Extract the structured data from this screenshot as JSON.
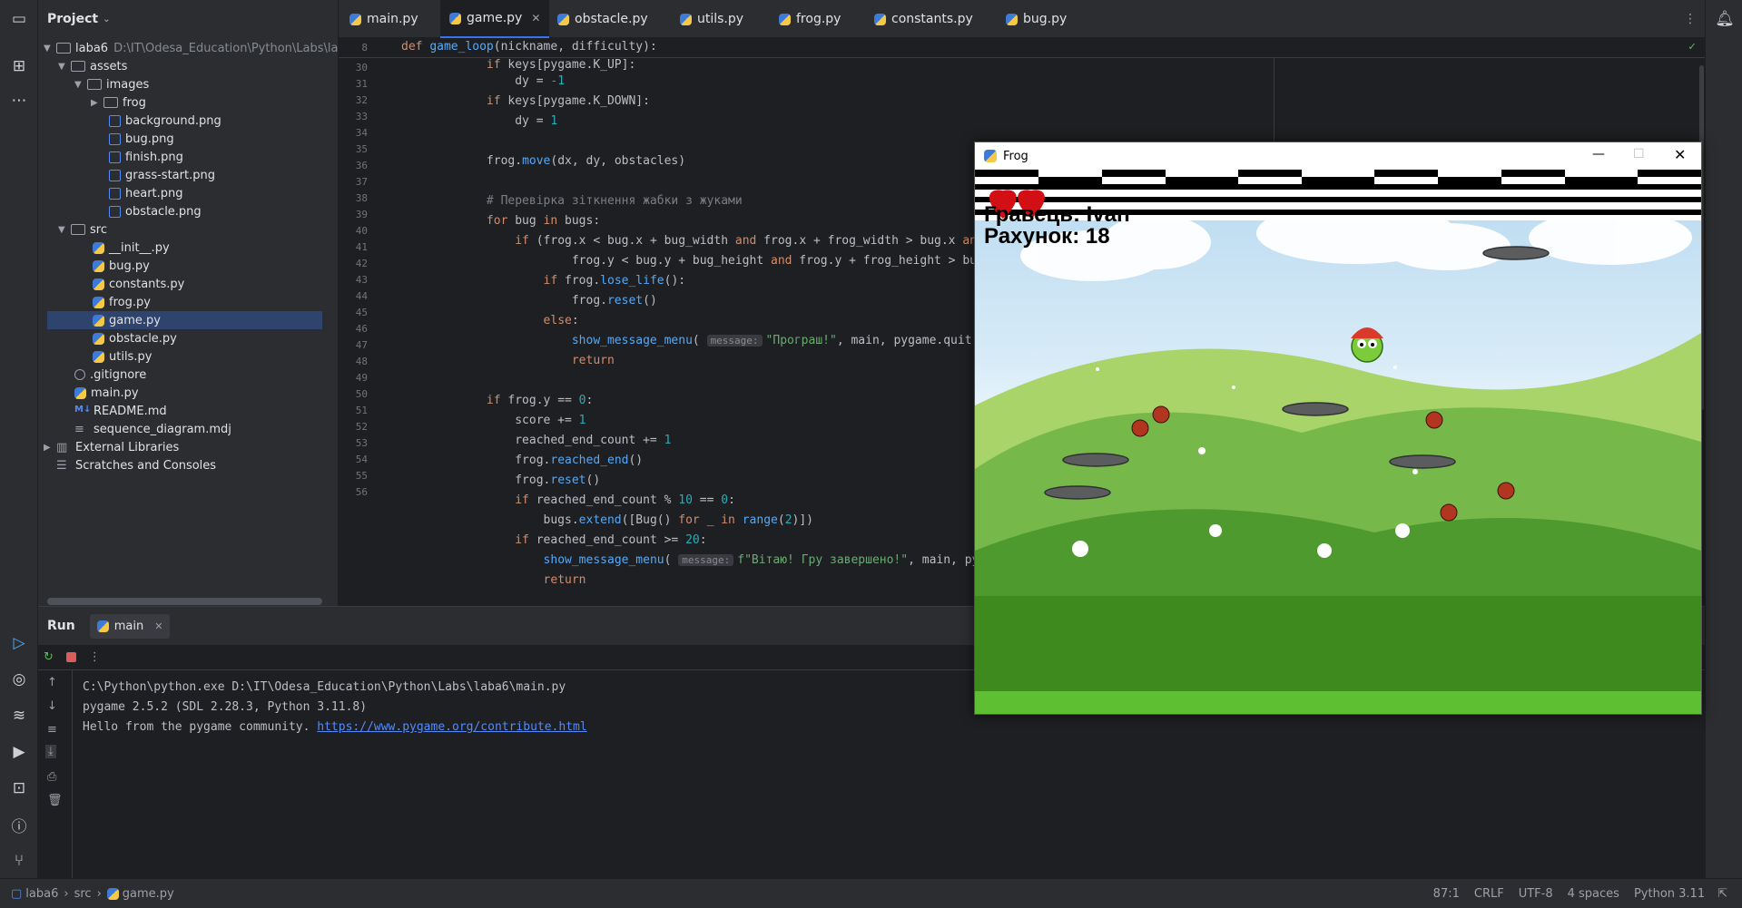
{
  "project": {
    "title": "Project",
    "root_name": "laba6",
    "root_path": "D:\\IT\\Odesa_Education\\Python\\Labs\\lab",
    "items": [
      {
        "label": "assets"
      },
      {
        "label": "images"
      },
      {
        "label": "frog"
      },
      {
        "label": "background.png"
      },
      {
        "label": "bug.png"
      },
      {
        "label": "finish.png"
      },
      {
        "label": "grass-start.png"
      },
      {
        "label": "heart.png"
      },
      {
        "label": "obstacle.png"
      },
      {
        "label": "src"
      },
      {
        "label": "__init__.py"
      },
      {
        "label": "bug.py"
      },
      {
        "label": "constants.py"
      },
      {
        "label": "frog.py"
      },
      {
        "label": "game.py"
      },
      {
        "label": "obstacle.py"
      },
      {
        "label": "utils.py"
      },
      {
        "label": ".gitignore"
      },
      {
        "label": "main.py"
      },
      {
        "label": "README.md"
      },
      {
        "label": "sequence_diagram.mdj"
      },
      {
        "label": "External Libraries"
      },
      {
        "label": "Scratches and Consoles"
      }
    ]
  },
  "tabs": [
    "main.py",
    "game.py",
    "obstacle.py",
    "utils.py",
    "frog.py",
    "constants.py",
    "bug.py"
  ],
  "editor": {
    "sticky_line": "8",
    "sticky_def": "def",
    "sticky_fn": "game_loop",
    "sticky_args": "(nickname, difficulty):",
    "line_numbers": [
      "30",
      "31",
      "32",
      "33",
      "34",
      "35",
      "36",
      "37",
      "38",
      "39",
      "40",
      "41",
      "42",
      "43",
      "44",
      "45",
      "46",
      "47",
      "48",
      "49",
      "50",
      "51",
      "52",
      "53",
      "54",
      "55",
      "56"
    ],
    "hint_message": "message:"
  },
  "run": {
    "tab_run": "Run",
    "tab_main": "main",
    "console": [
      "C:\\Python\\python.exe D:\\IT\\Odesa_Education\\Python\\Labs\\laba6\\main.py",
      "pygame 2.5.2 (SDL 2.28.3, Python 3.11.8)",
      "Hello from the pygame community. "
    ],
    "link": "https://www.pygame.org/contribute.html"
  },
  "status": {
    "crumbs": [
      "laba6",
      "src",
      "game.py"
    ],
    "position": "87:1",
    "line_sep": "CRLF",
    "encoding": "UTF-8",
    "indent": "4 spaces",
    "interpreter": "Python 3.11"
  },
  "game": {
    "window_title": "Frog",
    "player_label": "Гравець: Ivan",
    "score_label": "Рахунок: 18",
    "lives": 2
  },
  "colors": {
    "accent": "#3574f0",
    "keyword": "#cf8e6d",
    "function": "#56a8f5",
    "string": "#6aab73",
    "number": "#2aacb8"
  }
}
